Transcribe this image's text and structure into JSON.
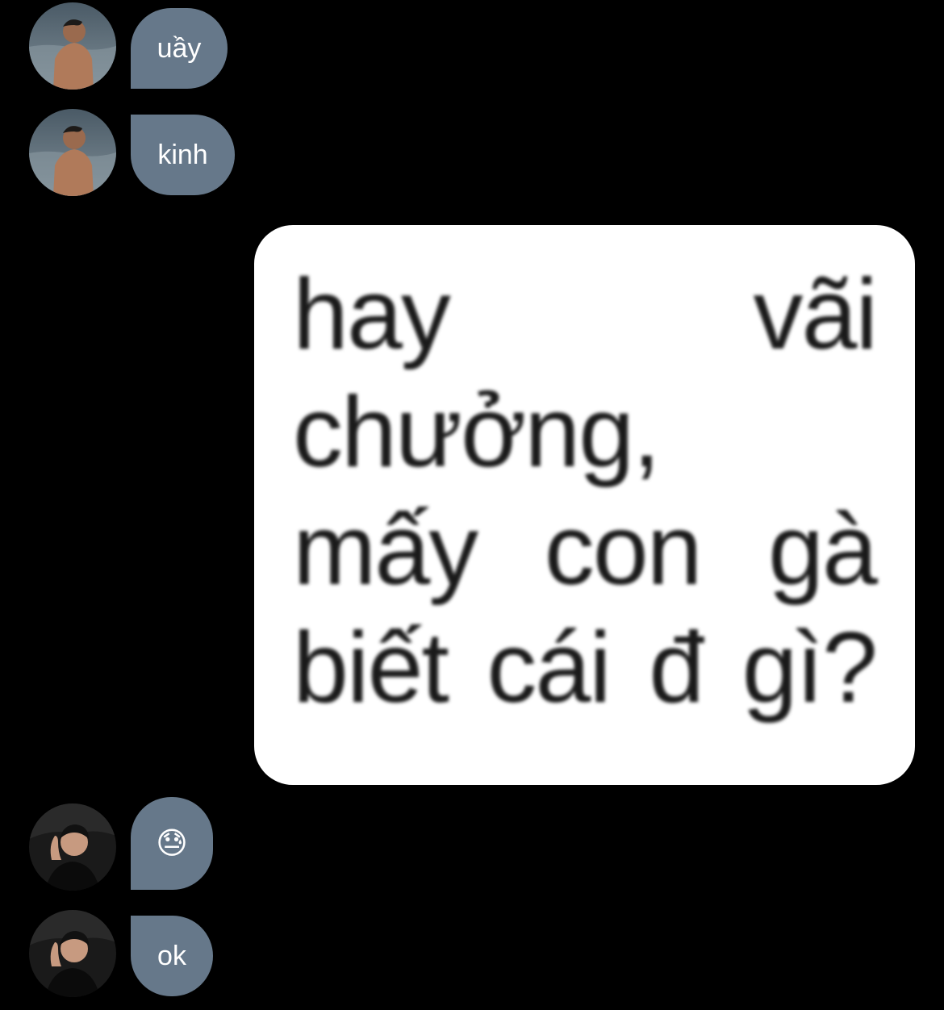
{
  "messages": [
    {
      "sender": "user-a",
      "text": "uầy"
    },
    {
      "sender": "user-a",
      "text": "kinh"
    },
    {
      "sender": "me",
      "sticker_lines": [
        [
          "hay",
          "vãi"
        ],
        [
          "chưởng,"
        ],
        [
          "mấy",
          "con",
          "gà"
        ],
        [
          "biết",
          "cái",
          "đ",
          "gì?"
        ]
      ]
    },
    {
      "sender": "user-b",
      "text": "😓"
    },
    {
      "sender": "user-b",
      "text": "ok"
    }
  ],
  "colors": {
    "background": "#000000",
    "incoming_bubble": "#66788a",
    "sticker_bg": "#ffffff"
  },
  "icons": {
    "user_a_avatar": "avatar-beach-photo",
    "user_b_avatar": "avatar-dark-photo"
  }
}
